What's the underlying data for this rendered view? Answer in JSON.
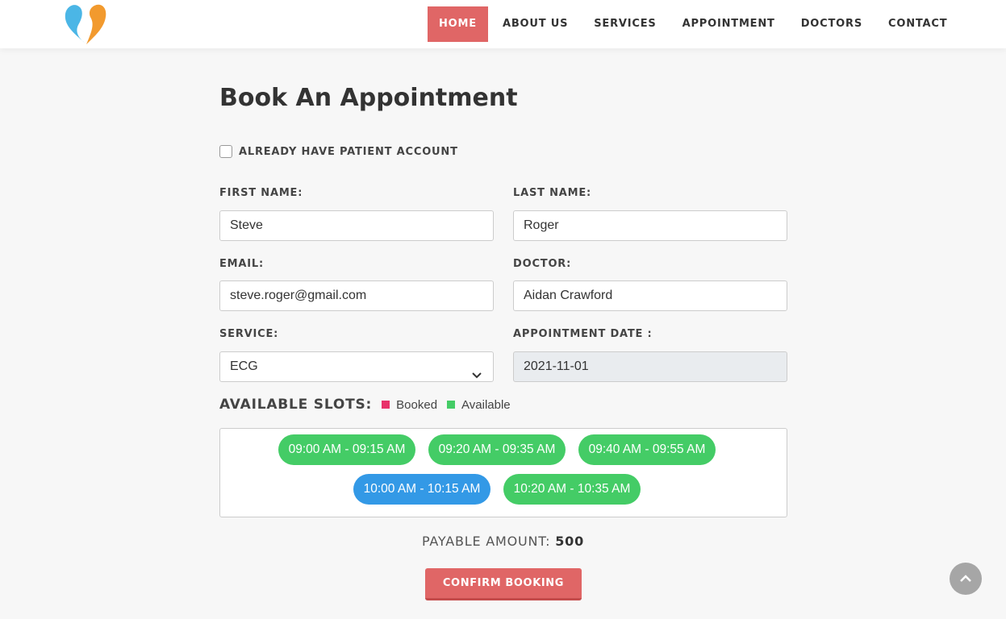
{
  "nav": {
    "items": [
      {
        "label": "HOME",
        "active": true
      },
      {
        "label": "ABOUT US"
      },
      {
        "label": "SERVICES"
      },
      {
        "label": "APPOINTMENT"
      },
      {
        "label": "DOCTORS"
      },
      {
        "label": "CONTACT"
      }
    ]
  },
  "page": {
    "title": "Book An Appointment",
    "existing_account_label": "ALREADY HAVE PATIENT ACCOUNT"
  },
  "form": {
    "first_name": {
      "label": "FIRST NAME:",
      "value": "Steve"
    },
    "last_name": {
      "label": "LAST NAME:",
      "value": "Roger"
    },
    "email": {
      "label": "EMAIL:",
      "value": "steve.roger@gmail.com"
    },
    "doctor": {
      "label": "DOCTOR:",
      "value": "Aidan Crawford"
    },
    "service": {
      "label": "SERVICE:",
      "value": "ECG"
    },
    "date": {
      "label": "APPOINTMENT DATE :",
      "value": "2021-11-01"
    }
  },
  "slots": {
    "title": "AVAILABLE SLOTS:",
    "legend": {
      "booked": "Booked",
      "available": "Available"
    },
    "colors": {
      "booked": "#e8336b",
      "available": "#44cc66",
      "selected": "#3399e6"
    },
    "items": [
      {
        "label": "09:00 AM - 09:15 AM",
        "state": "available"
      },
      {
        "label": "09:20 AM - 09:35 AM",
        "state": "available"
      },
      {
        "label": "09:40 AM - 09:55 AM",
        "state": "available"
      },
      {
        "label": "10:00 AM - 10:15 AM",
        "state": "selected"
      },
      {
        "label": "10:20 AM - 10:35 AM",
        "state": "available"
      }
    ]
  },
  "payment": {
    "label": "PAYABLE AMOUNT:",
    "amount": "500"
  },
  "actions": {
    "confirm_label": "CONFIRM BOOKING"
  },
  "icons": {
    "logo": "heart-logo-icon",
    "scroll": "chevron-up-icon",
    "select": "chevron-down-icon"
  }
}
